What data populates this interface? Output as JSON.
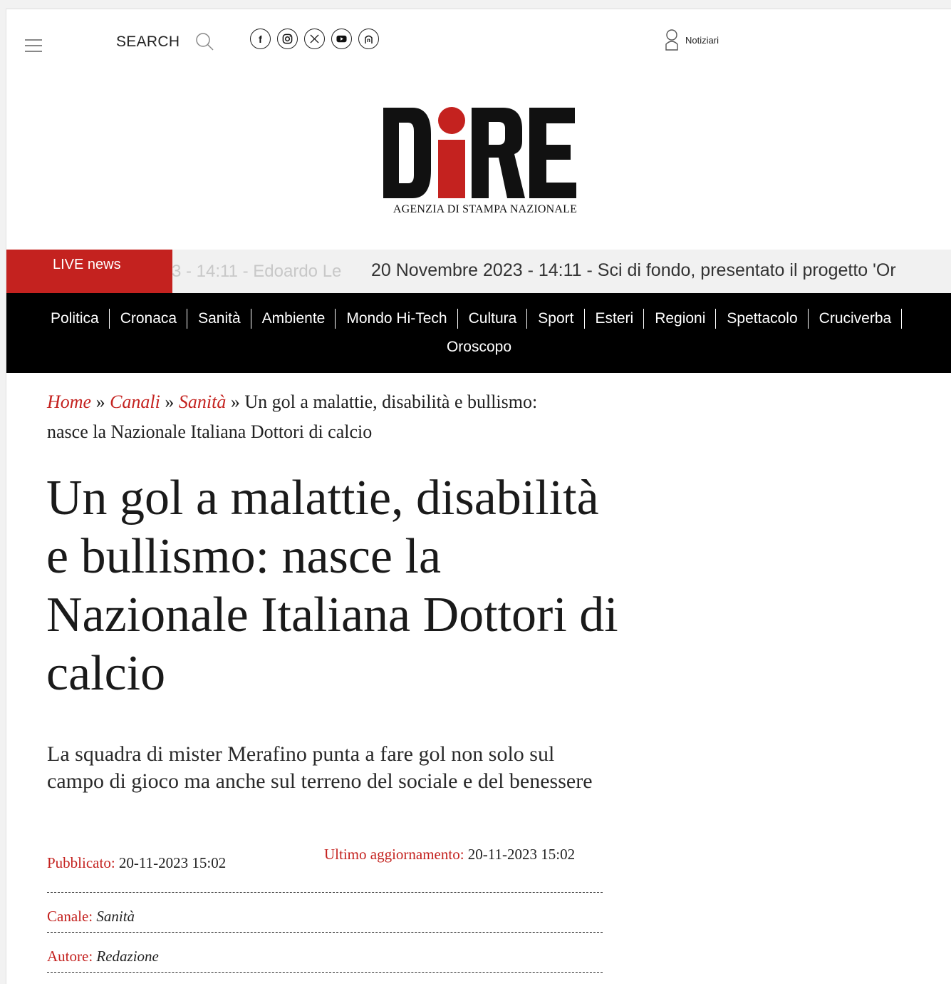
{
  "header": {
    "search_label": "SEARCH",
    "socials": [
      {
        "name": "facebook-icon"
      },
      {
        "name": "instagram-icon"
      },
      {
        "name": "x-icon"
      },
      {
        "name": "youtube-icon"
      },
      {
        "name": "newsletter-icon"
      }
    ],
    "notiziari_label": "Notiziari"
  },
  "logo": {
    "tagline": "AGENZIA DI STAMPA NAZIONALE"
  },
  "live": {
    "label": "LIVE news",
    "faded_text": "3 - 14:11 - Edoardo Le",
    "item_text": "20 Novembre 2023 - 14:11 - Sci di fondo, presentato il progetto 'Or"
  },
  "nav": {
    "items": [
      "Politica",
      "Cronaca",
      "Sanità",
      "Ambiente",
      "Mondo Hi-Tech",
      "Cultura",
      "Sport",
      "Esteri",
      "Regioni",
      "Spettacolo",
      "Cruciverba"
    ],
    "second_row": "Oroscopo"
  },
  "breadcrumb": {
    "home": "Home",
    "canali": "Canali",
    "sanita": "Sanità",
    "separator": "»",
    "current": "Un gol a malattie, disabilità e bullismo: nasce la Nazionale Italiana Dottori di calcio"
  },
  "article": {
    "title": "Un gol a malattie, disabilità e bullismo: nasce la Nazionale Italiana Dottori di calcio",
    "subtitle": "La squadra di mister Merafino punta a fare gol non solo sul campo di gioco ma anche sul terreno del sociale e del benessere",
    "published_label": "Pubblicato:",
    "published_value": "20-11-2023 15:02",
    "updated_label": "Ultimo aggiornamento:",
    "updated_value": "20-11-2023 15:02",
    "channel_label": "Canale:",
    "channel_value": "Sanità",
    "author_label": "Autore:",
    "author_value": "Redazione"
  },
  "colors": {
    "accent_red": "#c4221f",
    "nav_bg": "#000000"
  }
}
